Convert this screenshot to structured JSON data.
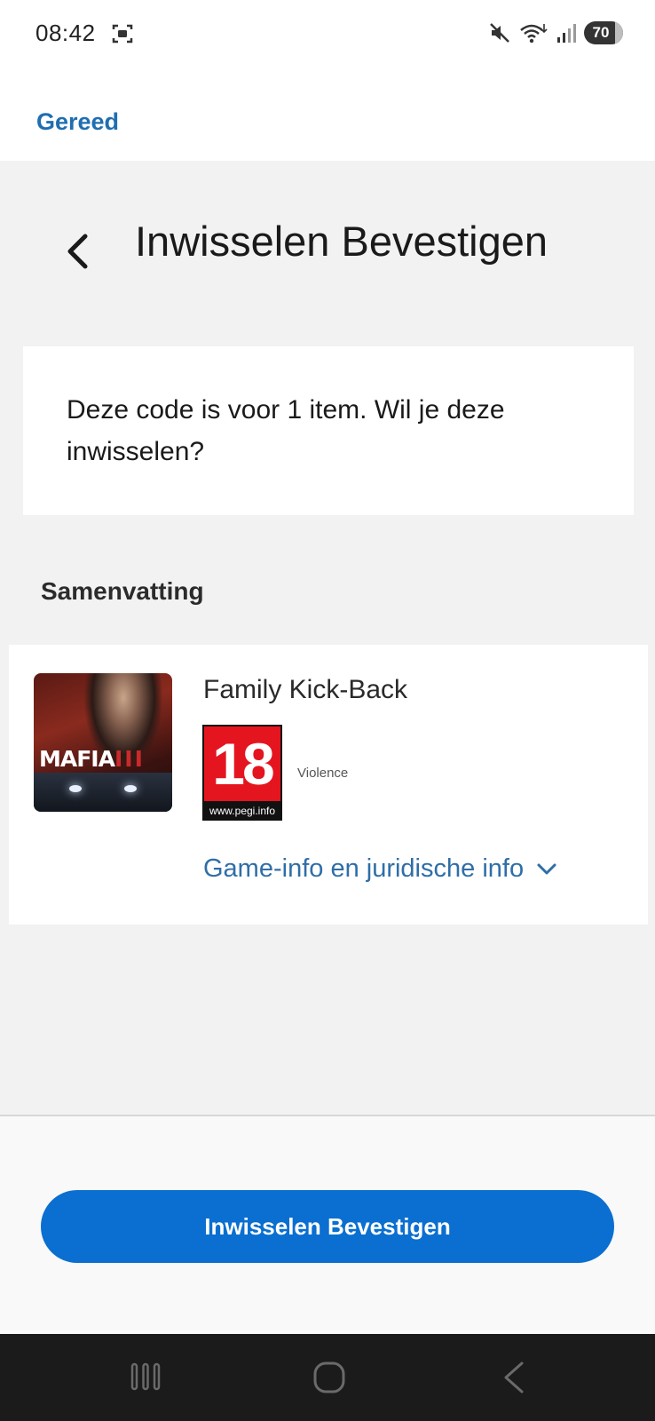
{
  "status_bar": {
    "time": "08:42",
    "battery_level": "70",
    "icons": [
      "screenshot-icon",
      "mute-icon",
      "wifi-icon",
      "signal-icon",
      "battery-icon"
    ]
  },
  "top_nav": {
    "done_label": "Gereed"
  },
  "header": {
    "title": "Inwisselen Bevestigen",
    "back_icon": "chevron-left-icon"
  },
  "message": {
    "text": "Deze code is voor 1 item. Wil je deze inwisselen?"
  },
  "summary": {
    "heading": "Samenvatting",
    "product": {
      "title": "Family Kick-Back",
      "cover_title": "MAFIA",
      "cover_numeral": "III",
      "rating": "18",
      "rating_url": "www.pegi.info",
      "descriptor": "Violence",
      "info_link": "Game-info en juridische info"
    }
  },
  "actions": {
    "confirm_label": "Inwisselen Bevestigen",
    "button_color": "#0a6fd0"
  },
  "system_nav": {
    "icons": [
      "recents-icon",
      "home-icon",
      "back-icon"
    ]
  }
}
